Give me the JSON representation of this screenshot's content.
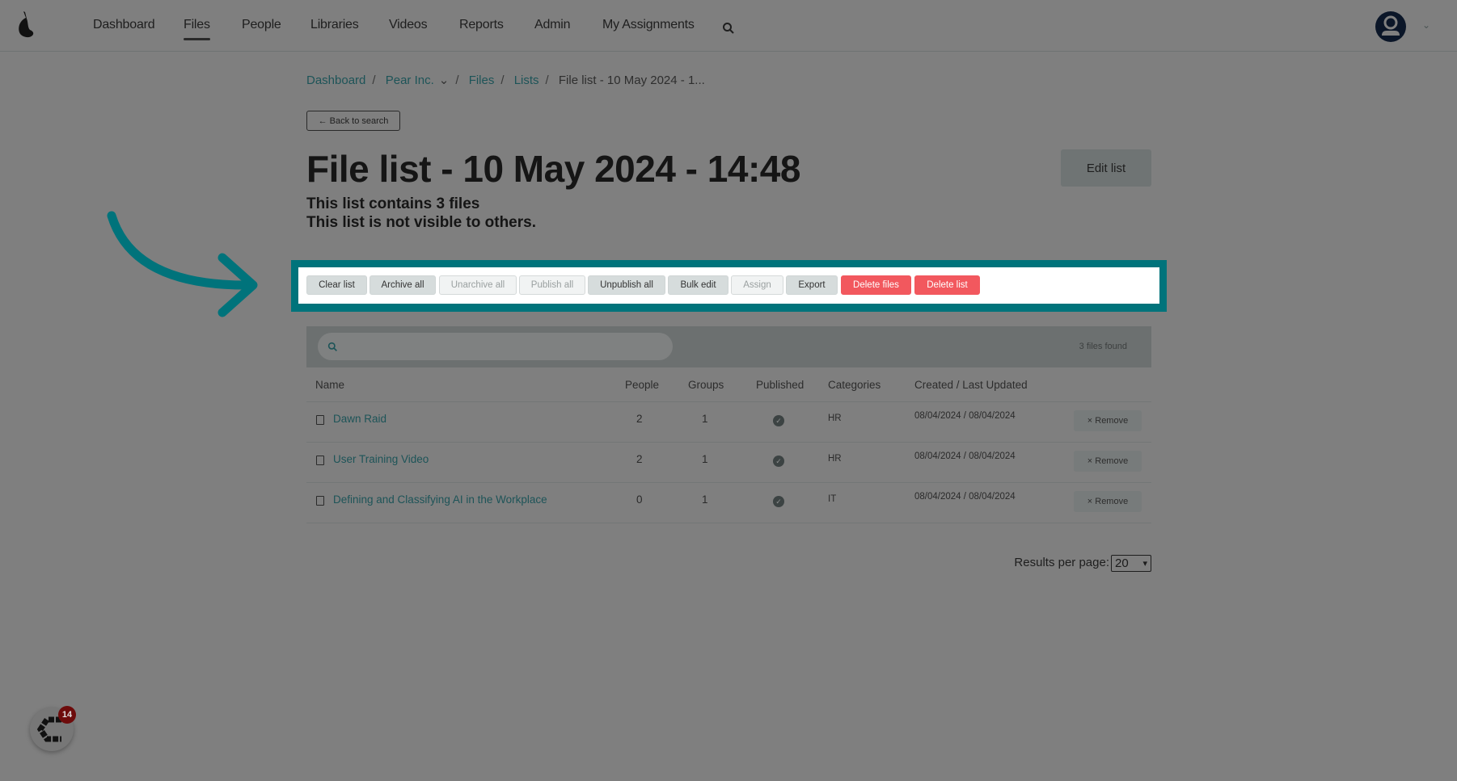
{
  "nav": {
    "items": [
      "Dashboard",
      "Files",
      "People",
      "Libraries",
      "Videos",
      "Reports",
      "Admin",
      "My Assignments"
    ],
    "active": "Files"
  },
  "breadcrumb": {
    "dashboard": "Dashboard",
    "org": "Pear Inc.",
    "files": "Files",
    "lists": "Lists",
    "current": "File list - 10 May 2024 - 1..."
  },
  "back_label": "← Back to search",
  "title": "File list - 10 May 2024 - 14:48",
  "subtitle1": "This list contains 3 files",
  "subtitle2": "This list is not visible to others.",
  "edit_label": "Edit list",
  "actions": [
    "Clear list",
    "Archive all",
    "Unarchive all",
    "Publish all",
    "Unpublish all",
    "Bulk edit",
    "Assign",
    "Export",
    "Delete files",
    "Delete list"
  ],
  "search": {
    "placeholder": "",
    "found": "3 files found"
  },
  "table": {
    "headers": [
      "Name",
      "People",
      "Groups",
      "Published",
      "Categories",
      "Created / Last Updated"
    ],
    "rows": [
      {
        "name": "Dawn Raid",
        "people": "2",
        "groups": "1",
        "published": true,
        "category": "HR",
        "dates": "08/04/2024 / 08/04/2024",
        "remove": "× Remove"
      },
      {
        "name": "User Training Video",
        "people": "2",
        "groups": "1",
        "published": true,
        "category": "HR",
        "dates": "08/04/2024 / 08/04/2024",
        "remove": "× Remove"
      },
      {
        "name": "Defining and Classifying AI in the Workplace",
        "people": "0",
        "groups": "1",
        "published": true,
        "category": "IT",
        "dates": "08/04/2024 / 08/04/2024",
        "remove": "× Remove"
      }
    ]
  },
  "pagination": {
    "label": "Results per page:",
    "value": "20"
  },
  "widget": {
    "badge": "14"
  },
  "colors": {
    "highlight": "#00737b",
    "danger": "#f2585e",
    "link": "#1d5458"
  }
}
